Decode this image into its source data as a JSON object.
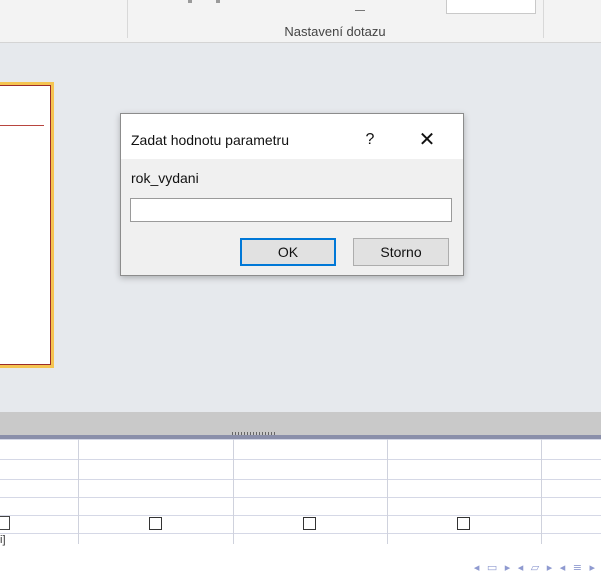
{
  "ribbon": {
    "group_label": "Nastavení dotazu"
  },
  "dialog": {
    "title": "Zadat hodnotu parametru",
    "help_glyph": "?",
    "close_glyph": "✕",
    "prompt_label": "rok_vydani",
    "input_value": "",
    "ok_label": "OK",
    "cancel_label": "Storno"
  },
  "grid": {
    "edge_text": "i]"
  },
  "nav": {
    "icons": "◂ ▭ ▸ ◂ ▱ ▸ ◂ ≡ ▸"
  }
}
